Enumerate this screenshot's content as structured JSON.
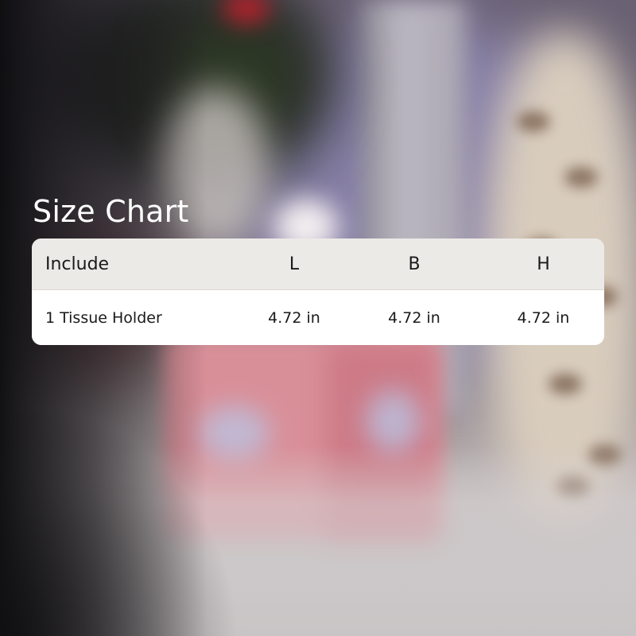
{
  "title": "Size Chart",
  "table": {
    "headers": [
      "Include",
      "L",
      "B",
      "H"
    ],
    "rows": [
      [
        "1 Tissue Holder",
        "4.72 in",
        "4.72 in",
        "4.72 in"
      ]
    ]
  },
  "colors": {
    "title_text": "#ffffff",
    "header_bg": "#eceae7",
    "row_bg": "#ffffff",
    "text": "#1a1a1a"
  }
}
